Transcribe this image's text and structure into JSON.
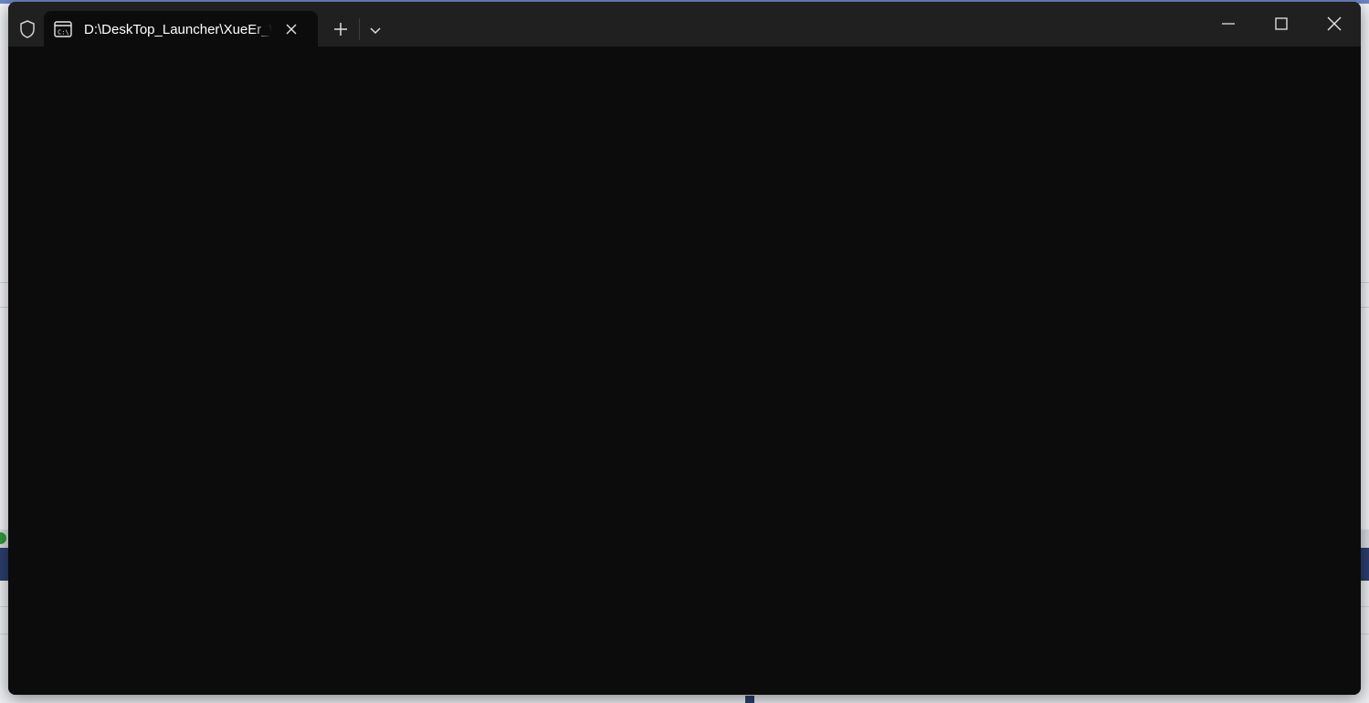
{
  "window": {
    "tab_title": "D:\\DeskTop_Launcher\\XueEr_W",
    "icons": {
      "shield": "shield-icon",
      "terminal": "terminal-icon",
      "tab_close": "close-icon",
      "new_tab": "plus-icon",
      "dropdown": "chevron-down-icon",
      "minimize": "minimize-icon",
      "maximize": "maximize-icon",
      "close": "close-icon"
    }
  },
  "colors": {
    "terminal_background": "#0c0c0c",
    "titlebar": "#202020",
    "tab_active": "#0c0c0c",
    "text": "#ffffff"
  }
}
